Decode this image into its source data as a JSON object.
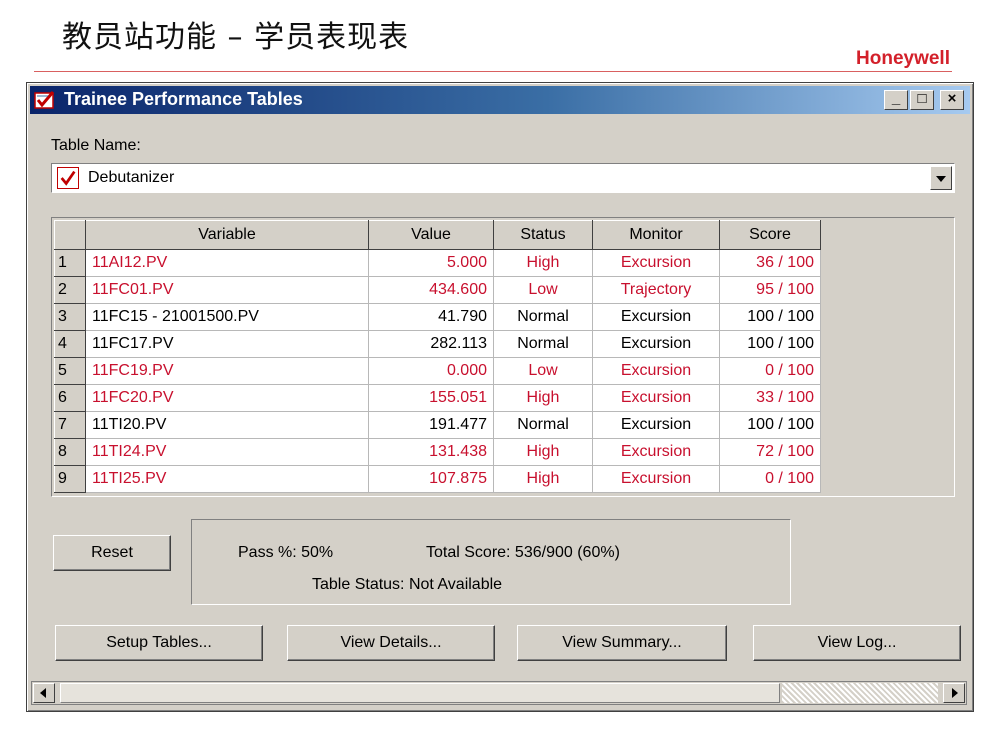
{
  "slide": {
    "title": "教员站功能 – 学员表现表",
    "brand": "Honeywell"
  },
  "window": {
    "title": "Trainee Performance Tables",
    "min_label": "_",
    "max_label": "□",
    "close_label": "×"
  },
  "table_name": {
    "label": "Table Name:",
    "selected": "Debutanizer"
  },
  "grid": {
    "headers": [
      "Variable",
      "Value",
      "Status",
      "Monitor",
      "Score"
    ],
    "rows": [
      {
        "num": "1",
        "variable": "11AI12.PV",
        "value": "5.000",
        "status": "High",
        "monitor": "Excursion",
        "score": "36 / 100",
        "alarm": true
      },
      {
        "num": "2",
        "variable": "11FC01.PV",
        "value": "434.600",
        "status": "Low",
        "monitor": "Trajectory",
        "score": "95 / 100",
        "alarm": true
      },
      {
        "num": "3",
        "variable": "11FC15 - 21001500.PV",
        "value": "41.790",
        "status": "Normal",
        "monitor": "Excursion",
        "score": "100 / 100",
        "alarm": false
      },
      {
        "num": "4",
        "variable": "11FC17.PV",
        "value": "282.113",
        "status": "Normal",
        "monitor": "Excursion",
        "score": "100 / 100",
        "alarm": false
      },
      {
        "num": "5",
        "variable": "11FC19.PV",
        "value": "0.000",
        "status": "Low",
        "monitor": "Excursion",
        "score": "0 / 100",
        "alarm": true
      },
      {
        "num": "6",
        "variable": "11FC20.PV",
        "value": "155.051",
        "status": "High",
        "monitor": "Excursion",
        "score": "33 / 100",
        "alarm": true
      },
      {
        "num": "7",
        "variable": "11TI20.PV",
        "value": "191.477",
        "status": "Normal",
        "monitor": "Excursion",
        "score": "100 / 100",
        "alarm": false
      },
      {
        "num": "8",
        "variable": "11TI24.PV",
        "value": "131.438",
        "status": "High",
        "monitor": "Excursion",
        "score": "72 / 100",
        "alarm": true
      },
      {
        "num": "9",
        "variable": "11TI25.PV",
        "value": "107.875",
        "status": "High",
        "monitor": "Excursion",
        "score": "0 / 100",
        "alarm": true
      }
    ]
  },
  "summary": {
    "reset_label": "Reset",
    "pass": "Pass %: 50%",
    "total_score": "Total Score: 536/900 (60%)",
    "table_status": "Table Status: Not Available"
  },
  "buttons": {
    "setup": "Setup Tables...",
    "details": "View Details...",
    "summary": "View Summary...",
    "log": "View Log..."
  },
  "colors": {
    "alarm_text": "#c8102e",
    "brand_red": "#d3202a",
    "title_bar": "#0a246a"
  }
}
